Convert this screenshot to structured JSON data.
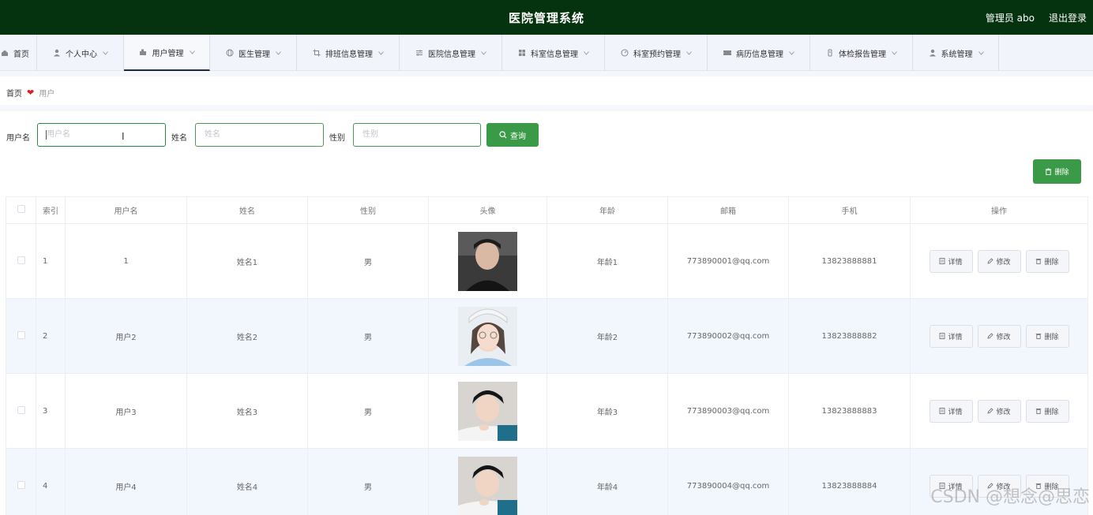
{
  "header": {
    "title": "医院管理系统",
    "user": "管理员 abo",
    "logout": "退出登录"
  },
  "nav": [
    {
      "label": "首页",
      "icon": "home-icon",
      "width": 47
    },
    {
      "label": "个人中心",
      "icon": "person-icon",
      "width": 110
    },
    {
      "label": "用户管理",
      "icon": "users-icon",
      "width": 109,
      "active": true
    },
    {
      "label": "医生管理",
      "icon": "globe-icon",
      "width": 110
    },
    {
      "label": "排班信息管理",
      "icon": "crop-icon",
      "width": 130
    },
    {
      "label": "医院信息管理",
      "icon": "sliders-icon",
      "width": 130
    },
    {
      "label": "科室信息管理",
      "icon": "grid-icon",
      "width": 130
    },
    {
      "label": "科室预约管理",
      "icon": "gauge-icon",
      "width": 130
    },
    {
      "label": "病历信息管理",
      "icon": "ticket-icon",
      "width": 130
    },
    {
      "label": "体检报告管理",
      "icon": "file-icon",
      "width": 130
    },
    {
      "label": "系统管理",
      "icon": "person-icon",
      "width": 109
    }
  ],
  "breadcrumb": {
    "home": "首页",
    "current": "用户"
  },
  "search": {
    "username_label": "用户名",
    "username_placeholder": "用户名",
    "name_label": "姓名",
    "name_placeholder": "姓名",
    "gender_label": "性别",
    "gender_placeholder": "性别",
    "button": "查询"
  },
  "toolbar": {
    "delete": "删除"
  },
  "table": {
    "headers": [
      "索引",
      "用户名",
      "姓名",
      "性别",
      "头像",
      "年龄",
      "邮箱",
      "手机",
      "操作"
    ],
    "rows": [
      {
        "index": "1",
        "username": "1",
        "name": "姓名1",
        "gender": "男",
        "age": "年龄1",
        "email": "773890001@qq.com",
        "phone": "13823888881"
      },
      {
        "index": "2",
        "username": "用户2",
        "name": "姓名2",
        "gender": "男",
        "age": "年龄2",
        "email": "773890002@qq.com",
        "phone": "13823888882"
      },
      {
        "index": "3",
        "username": "用户3",
        "name": "姓名3",
        "gender": "男",
        "age": "年龄3",
        "email": "773890003@qq.com",
        "phone": "13823888883"
      },
      {
        "index": "4",
        "username": "用户4",
        "name": "姓名4",
        "gender": "男",
        "age": "年龄4",
        "email": "773890004@qq.com",
        "phone": "13823888884"
      }
    ],
    "actions": {
      "detail": "详情",
      "edit": "修改",
      "delete": "删除"
    }
  },
  "watermark": "CSDN @想念@思恋",
  "colors": {
    "header_bg": "#06330f",
    "accent": "#3b9a47",
    "row_alt": "#f2f7fd"
  }
}
